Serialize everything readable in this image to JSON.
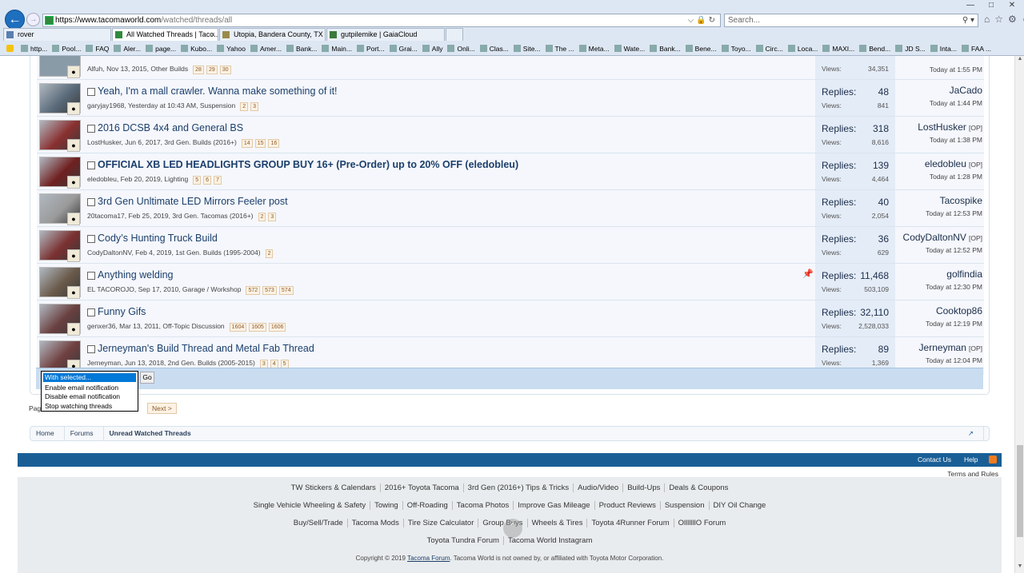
{
  "browser": {
    "url_domain": "https://www.tacomaworld.com",
    "url_path": "/watched/threads/all",
    "search_placeholder": "Search...",
    "tabs": [
      {
        "label": "rover"
      },
      {
        "label": "All Watched Threads | Taco..."
      },
      {
        "label": "Utopia, Bandera County, TX Fa..."
      },
      {
        "label": "gutpilemike | GaiaCloud"
      }
    ],
    "bookmarks": [
      "http...",
      "Pool...",
      "FAQ",
      "Aler...",
      "page...",
      "Kubo...",
      "Yahoo",
      "Amer...",
      "Bank...",
      "Main...",
      "Port...",
      "Grai...",
      "Ally",
      "Onli...",
      "Clas...",
      "Site...",
      "The ...",
      "Meta...",
      "Wate...",
      "Bank...",
      "Bene...",
      "Toyo...",
      "Circ...",
      "Loca...",
      "MAXI...",
      "Bend...",
      "JD S...",
      "Inta...",
      "FAA ..."
    ]
  },
  "partial_row": {
    "meta": "Alfuh, Nov 13, 2015, Other Builds",
    "pages": [
      "28",
      "29",
      "30"
    ],
    "views": "34,351",
    "time": "Today at 1:55 PM"
  },
  "threads": [
    {
      "title": "Yeah, I'm a mall crawler. Wanna make something of it!",
      "meta": "garyjay1968, Yesterday at 10:43 AM, Suspension",
      "pages": [
        "2",
        "3"
      ],
      "replies_label": "Replies:",
      "replies": "48",
      "views_label": "Views:",
      "views": "841",
      "last_user": "JaCado",
      "op": "",
      "last_time": "Today at 1:44 PM"
    },
    {
      "title": "2016 DCSB 4x4 and General BS",
      "meta": "LostHusker, Jun 6, 2017, 3rd Gen. Builds (2016+)",
      "pages": [
        "14",
        "15",
        "16"
      ],
      "replies_label": "Replies:",
      "replies": "318",
      "views_label": "Views:",
      "views": "8,616",
      "last_user": "LostHusker",
      "op": "[OP]",
      "last_time": "Today at 1:38 PM"
    },
    {
      "title": "OFFICIAL XB LED HEADLIGHTS GROUP BUY 16+ (Pre-Order) up to 20% OFF (eledobleu)",
      "bold": true,
      "meta": "eledobleu, Feb 20, 2019, Lighting",
      "pages": [
        "5",
        "6",
        "7"
      ],
      "replies_label": "Replies:",
      "replies": "139",
      "views_label": "Views:",
      "views": "4,464",
      "last_user": "eledobleu",
      "op": "[OP]",
      "last_time": "Today at 1:28 PM"
    },
    {
      "title": "3rd Gen Unltimate LED Mirrors Feeler post",
      "meta": "20tacoma17, Feb 25, 2019, 3rd Gen. Tacomas (2016+)",
      "pages": [
        "2",
        "3"
      ],
      "replies_label": "Replies:",
      "replies": "40",
      "views_label": "Views:",
      "views": "2,054",
      "last_user": "Tacospike",
      "op": "",
      "last_time": "Today at 12:53 PM"
    },
    {
      "title": "Cody’s Hunting Truck Build",
      "meta": "CodyDaltonNV, Feb 4, 2019, 1st Gen. Builds (1995-2004)",
      "pages": [
        "2"
      ],
      "replies_label": "Replies:",
      "replies": "36",
      "views_label": "Views:",
      "views": "629",
      "last_user": "CodyDaltonNV",
      "op": "[OP]",
      "last_time": "Today at 12:52 PM"
    },
    {
      "title": "Anything welding",
      "pinned": true,
      "meta": "EL TACOROJO, Sep 17, 2010, Garage / Workshop",
      "pages": [
        "572",
        "573",
        "574"
      ],
      "replies_label": "Replies:",
      "replies": "11,468",
      "views_label": "Views:",
      "views": "503,109",
      "last_user": "golfindia",
      "op": "",
      "last_time": "Today at 12:30 PM"
    },
    {
      "title": "Funny Gifs",
      "meta": "genxer36, Mar 13, 2011, Off-Topic Discussion",
      "pages": [
        "1604",
        "1605",
        "1606"
      ],
      "replies_label": "Replies:",
      "replies": "32,110",
      "views_label": "Views:",
      "views": "2,528,033",
      "last_user": "Cooktop86",
      "op": "",
      "last_time": "Today at 12:19 PM"
    },
    {
      "title": "Jerneyman's Build Thread and Metal Fab Thread",
      "meta": "Jerneyman, Jun 13, 2018, 2nd Gen. Builds (2005-2015)",
      "pages": [
        "3",
        "4",
        "5"
      ],
      "replies_label": "Replies:",
      "replies": "89",
      "views_label": "Views:",
      "views": "1,369",
      "last_user": "Jerneyman",
      "op": "[OP]",
      "last_time": "Today at 12:04 PM"
    }
  ],
  "dropdown": {
    "options": [
      "With selected...",
      "Enable email notification",
      "Disable email notification",
      "Stop watching threads"
    ],
    "go": "Go"
  },
  "pagenav": {
    "label": "Page",
    "next": "Next >"
  },
  "breadcrumb": [
    "Home",
    "Forums",
    "Unread Watched Threads"
  ],
  "footer": {
    "contact": "Contact Us",
    "help": "Help",
    "terms": "Terms and Rules",
    "link_rows": [
      [
        "TW Stickers & Calendars",
        "2016+ Toyota Tacoma",
        "3rd Gen (2016+) Tips & Tricks",
        "Audio/Video",
        "Build-Ups",
        "Deals & Coupons"
      ],
      [
        "Single Vehicle Wheeling & Safety",
        "Towing",
        "Off-Roading",
        "Tacoma Photos",
        "Improve Gas Mileage",
        "Product Reviews",
        "Suspension",
        "DIY Oil Change"
      ],
      [
        "Buy/Sell/Trade",
        "Tacoma Mods",
        "Tire Size Calculator",
        "Group Buys",
        "Wheels & Tires",
        "Toyota 4Runner Forum",
        "OlllllllO Forum"
      ],
      [
        "Toyota Tundra Forum",
        "Tacoma World Instagram"
      ]
    ],
    "copyright_pre": "Copyright © 2019 ",
    "copyright_link": "Tacoma Forum",
    "copyright_post": ". Tacoma World is not owned by, or affiliated with Toyota Motor Corporation."
  }
}
